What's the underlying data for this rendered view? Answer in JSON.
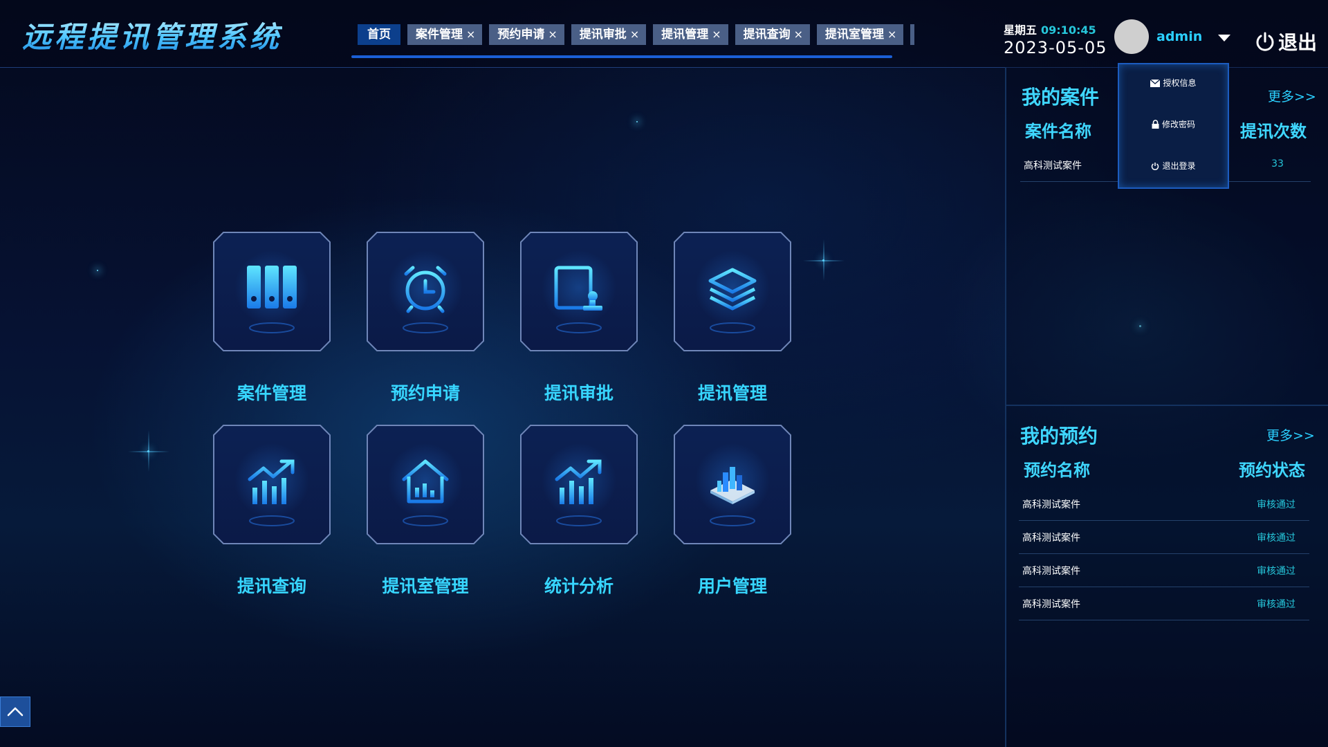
{
  "app": {
    "title": "远程提讯管理系统"
  },
  "tabs": [
    {
      "label": "首页",
      "active": true,
      "closable": false
    },
    {
      "label": "案件管理",
      "active": false,
      "closable": true
    },
    {
      "label": "预约申请",
      "active": false,
      "closable": true
    },
    {
      "label": "提讯审批",
      "active": false,
      "closable": true
    },
    {
      "label": "提讯管理",
      "active": false,
      "closable": true
    },
    {
      "label": "提讯查询",
      "active": false,
      "closable": true
    },
    {
      "label": "提讯室管理",
      "active": false,
      "closable": true
    }
  ],
  "tab_close_glyph": "×",
  "header": {
    "weekday": "星期五",
    "time": "09:10:45",
    "date": "2023-05-05",
    "username": "admin",
    "logout_label": "退出"
  },
  "user_menu": [
    {
      "label": "授权信息",
      "icon": "envelope-icon"
    },
    {
      "label": "修改密码",
      "icon": "lock-icon"
    },
    {
      "label": "退出登录",
      "icon": "power-icon"
    }
  ],
  "tiles": [
    {
      "label": "案件管理",
      "icon": "binders-icon"
    },
    {
      "label": "预约申请",
      "icon": "alarm-clock-icon"
    },
    {
      "label": "提讯审批",
      "icon": "document-stamp-icon"
    },
    {
      "label": "提讯管理",
      "icon": "layers-icon"
    },
    {
      "label": "提讯查询",
      "icon": "trend-chart-icon"
    },
    {
      "label": "提讯室管理",
      "icon": "house-chart-icon"
    },
    {
      "label": "统计分析",
      "icon": "trend-chart-icon"
    },
    {
      "label": "用户管理",
      "icon": "isometric-city-icon"
    }
  ],
  "my_cases": {
    "title": "我的案件",
    "more": "更多>>",
    "col1": "案件名称",
    "col2": "提讯次数",
    "rows": [
      {
        "name": "高科测试案件",
        "value": "33"
      }
    ]
  },
  "my_appointments": {
    "title": "我的预约",
    "more": "更多>>",
    "col1": "预约名称",
    "col2": "预约状态",
    "rows": [
      {
        "name": "高科测试案件",
        "value": "审核通过"
      },
      {
        "name": "高科测试案件",
        "value": "审核通过"
      },
      {
        "name": "高科测试案件",
        "value": "审核通过"
      },
      {
        "name": "高科测试案件",
        "value": "审核通过"
      }
    ]
  },
  "colors": {
    "accent": "#37d6ff",
    "tab_bg": "#4a5f86",
    "tab_active": "#0c3f8c",
    "status": "#26c6da"
  }
}
